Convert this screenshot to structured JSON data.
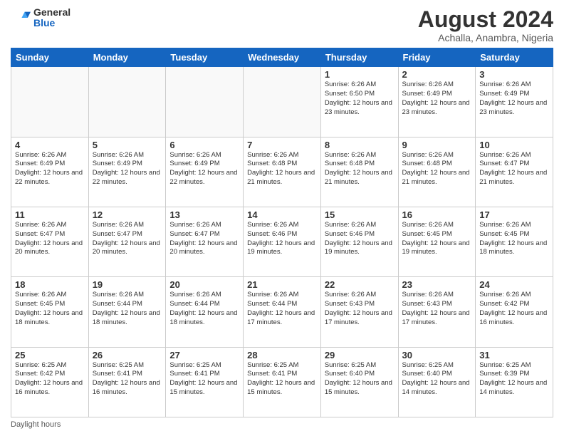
{
  "logo": {
    "general": "General",
    "blue": "Blue"
  },
  "title": "August 2024",
  "subtitle": "Achalla, Anambra, Nigeria",
  "days_of_week": [
    "Sunday",
    "Monday",
    "Tuesday",
    "Wednesday",
    "Thursday",
    "Friday",
    "Saturday"
  ],
  "footer": "Daylight hours",
  "weeks": [
    [
      {
        "day": "",
        "info": ""
      },
      {
        "day": "",
        "info": ""
      },
      {
        "day": "",
        "info": ""
      },
      {
        "day": "",
        "info": ""
      },
      {
        "day": "1",
        "info": "Sunrise: 6:26 AM\nSunset: 6:50 PM\nDaylight: 12 hours and 23 minutes."
      },
      {
        "day": "2",
        "info": "Sunrise: 6:26 AM\nSunset: 6:49 PM\nDaylight: 12 hours and 23 minutes."
      },
      {
        "day": "3",
        "info": "Sunrise: 6:26 AM\nSunset: 6:49 PM\nDaylight: 12 hours and 23 minutes."
      }
    ],
    [
      {
        "day": "4",
        "info": "Sunrise: 6:26 AM\nSunset: 6:49 PM\nDaylight: 12 hours and 22 minutes."
      },
      {
        "day": "5",
        "info": "Sunrise: 6:26 AM\nSunset: 6:49 PM\nDaylight: 12 hours and 22 minutes."
      },
      {
        "day": "6",
        "info": "Sunrise: 6:26 AM\nSunset: 6:49 PM\nDaylight: 12 hours and 22 minutes."
      },
      {
        "day": "7",
        "info": "Sunrise: 6:26 AM\nSunset: 6:48 PM\nDaylight: 12 hours and 21 minutes."
      },
      {
        "day": "8",
        "info": "Sunrise: 6:26 AM\nSunset: 6:48 PM\nDaylight: 12 hours and 21 minutes."
      },
      {
        "day": "9",
        "info": "Sunrise: 6:26 AM\nSunset: 6:48 PM\nDaylight: 12 hours and 21 minutes."
      },
      {
        "day": "10",
        "info": "Sunrise: 6:26 AM\nSunset: 6:47 PM\nDaylight: 12 hours and 21 minutes."
      }
    ],
    [
      {
        "day": "11",
        "info": "Sunrise: 6:26 AM\nSunset: 6:47 PM\nDaylight: 12 hours and 20 minutes."
      },
      {
        "day": "12",
        "info": "Sunrise: 6:26 AM\nSunset: 6:47 PM\nDaylight: 12 hours and 20 minutes."
      },
      {
        "day": "13",
        "info": "Sunrise: 6:26 AM\nSunset: 6:47 PM\nDaylight: 12 hours and 20 minutes."
      },
      {
        "day": "14",
        "info": "Sunrise: 6:26 AM\nSunset: 6:46 PM\nDaylight: 12 hours and 19 minutes."
      },
      {
        "day": "15",
        "info": "Sunrise: 6:26 AM\nSunset: 6:46 PM\nDaylight: 12 hours and 19 minutes."
      },
      {
        "day": "16",
        "info": "Sunrise: 6:26 AM\nSunset: 6:45 PM\nDaylight: 12 hours and 19 minutes."
      },
      {
        "day": "17",
        "info": "Sunrise: 6:26 AM\nSunset: 6:45 PM\nDaylight: 12 hours and 18 minutes."
      }
    ],
    [
      {
        "day": "18",
        "info": "Sunrise: 6:26 AM\nSunset: 6:45 PM\nDaylight: 12 hours and 18 minutes."
      },
      {
        "day": "19",
        "info": "Sunrise: 6:26 AM\nSunset: 6:44 PM\nDaylight: 12 hours and 18 minutes."
      },
      {
        "day": "20",
        "info": "Sunrise: 6:26 AM\nSunset: 6:44 PM\nDaylight: 12 hours and 18 minutes."
      },
      {
        "day": "21",
        "info": "Sunrise: 6:26 AM\nSunset: 6:44 PM\nDaylight: 12 hours and 17 minutes."
      },
      {
        "day": "22",
        "info": "Sunrise: 6:26 AM\nSunset: 6:43 PM\nDaylight: 12 hours and 17 minutes."
      },
      {
        "day": "23",
        "info": "Sunrise: 6:26 AM\nSunset: 6:43 PM\nDaylight: 12 hours and 17 minutes."
      },
      {
        "day": "24",
        "info": "Sunrise: 6:26 AM\nSunset: 6:42 PM\nDaylight: 12 hours and 16 minutes."
      }
    ],
    [
      {
        "day": "25",
        "info": "Sunrise: 6:25 AM\nSunset: 6:42 PM\nDaylight: 12 hours and 16 minutes."
      },
      {
        "day": "26",
        "info": "Sunrise: 6:25 AM\nSunset: 6:41 PM\nDaylight: 12 hours and 16 minutes."
      },
      {
        "day": "27",
        "info": "Sunrise: 6:25 AM\nSunset: 6:41 PM\nDaylight: 12 hours and 15 minutes."
      },
      {
        "day": "28",
        "info": "Sunrise: 6:25 AM\nSunset: 6:41 PM\nDaylight: 12 hours and 15 minutes."
      },
      {
        "day": "29",
        "info": "Sunrise: 6:25 AM\nSunset: 6:40 PM\nDaylight: 12 hours and 15 minutes."
      },
      {
        "day": "30",
        "info": "Sunrise: 6:25 AM\nSunset: 6:40 PM\nDaylight: 12 hours and 14 minutes."
      },
      {
        "day": "31",
        "info": "Sunrise: 6:25 AM\nSunset: 6:39 PM\nDaylight: 12 hours and 14 minutes."
      }
    ]
  ]
}
